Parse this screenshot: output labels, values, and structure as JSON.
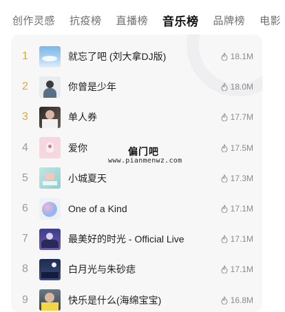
{
  "tabs": [
    {
      "label": "创作灵感",
      "active": false
    },
    {
      "label": "抗疫榜",
      "active": false
    },
    {
      "label": "直播榜",
      "active": false
    },
    {
      "label": "音乐榜",
      "active": true
    },
    {
      "label": "品牌榜",
      "active": false
    },
    {
      "label": "电影",
      "active": false
    }
  ],
  "songs": [
    {
      "rank": "1",
      "title": "就忘了吧 (刘大拿DJ版)",
      "heat": "18.1M"
    },
    {
      "rank": "2",
      "title": "你曾是少年",
      "heat": "18.0M"
    },
    {
      "rank": "3",
      "title": "单人券",
      "heat": "17.7M"
    },
    {
      "rank": "4",
      "title": "爱你",
      "heat": "17.5M"
    },
    {
      "rank": "5",
      "title": "小城夏天",
      "heat": "17.3M"
    },
    {
      "rank": "6",
      "title": "One of a Kind",
      "heat": "17.1M"
    },
    {
      "rank": "7",
      "title": "最美好的时光 - Official Live",
      "heat": "17.1M"
    },
    {
      "rank": "8",
      "title": "白月光与朱砂痣",
      "heat": "17.1M"
    },
    {
      "rank": "9",
      "title": "快乐是什么(海绵宝宝)",
      "heat": "16.8M"
    }
  ],
  "colors": {
    "top_rank": "#e8a52a",
    "rank": "#9a9a9a",
    "heat_icon": "flame-icon"
  },
  "watermark": {
    "name": "偏门吧",
    "url": "www.pianmenwz.com"
  }
}
